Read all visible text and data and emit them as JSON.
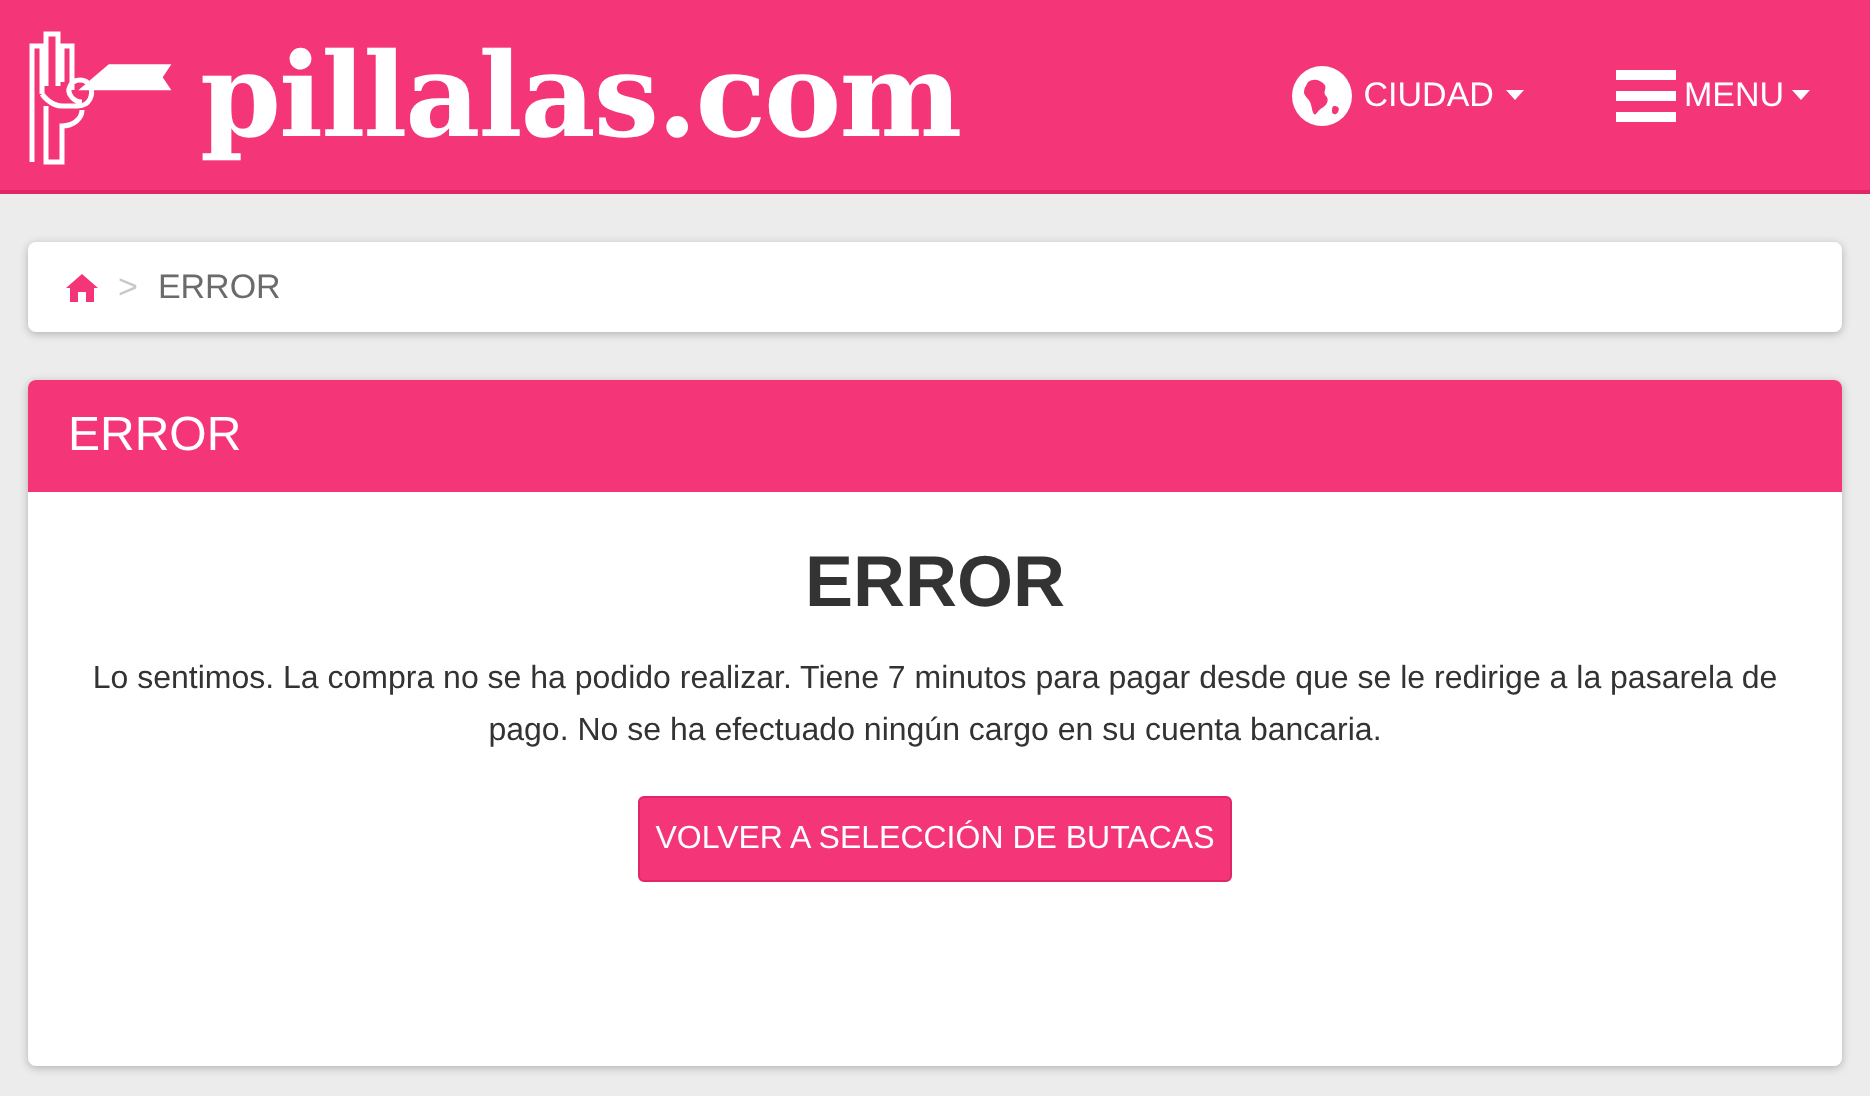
{
  "header": {
    "logo": "pillalas.com",
    "city_menu": "CIUDAD",
    "main_menu": "MENU"
  },
  "breadcrumb": {
    "separator": ">",
    "current": "ERROR"
  },
  "panel": {
    "title": "ERROR",
    "heading": "ERROR",
    "message": "Lo sentimos. La compra no se ha podido realizar. Tiene 7 minutos para pagar desde que se le redirige a la pasarela de pago. No se ha efectuado ningún cargo en su cuenta bancaria.",
    "button": "VOLVER A SELECCIÓN DE BUTACAS"
  }
}
